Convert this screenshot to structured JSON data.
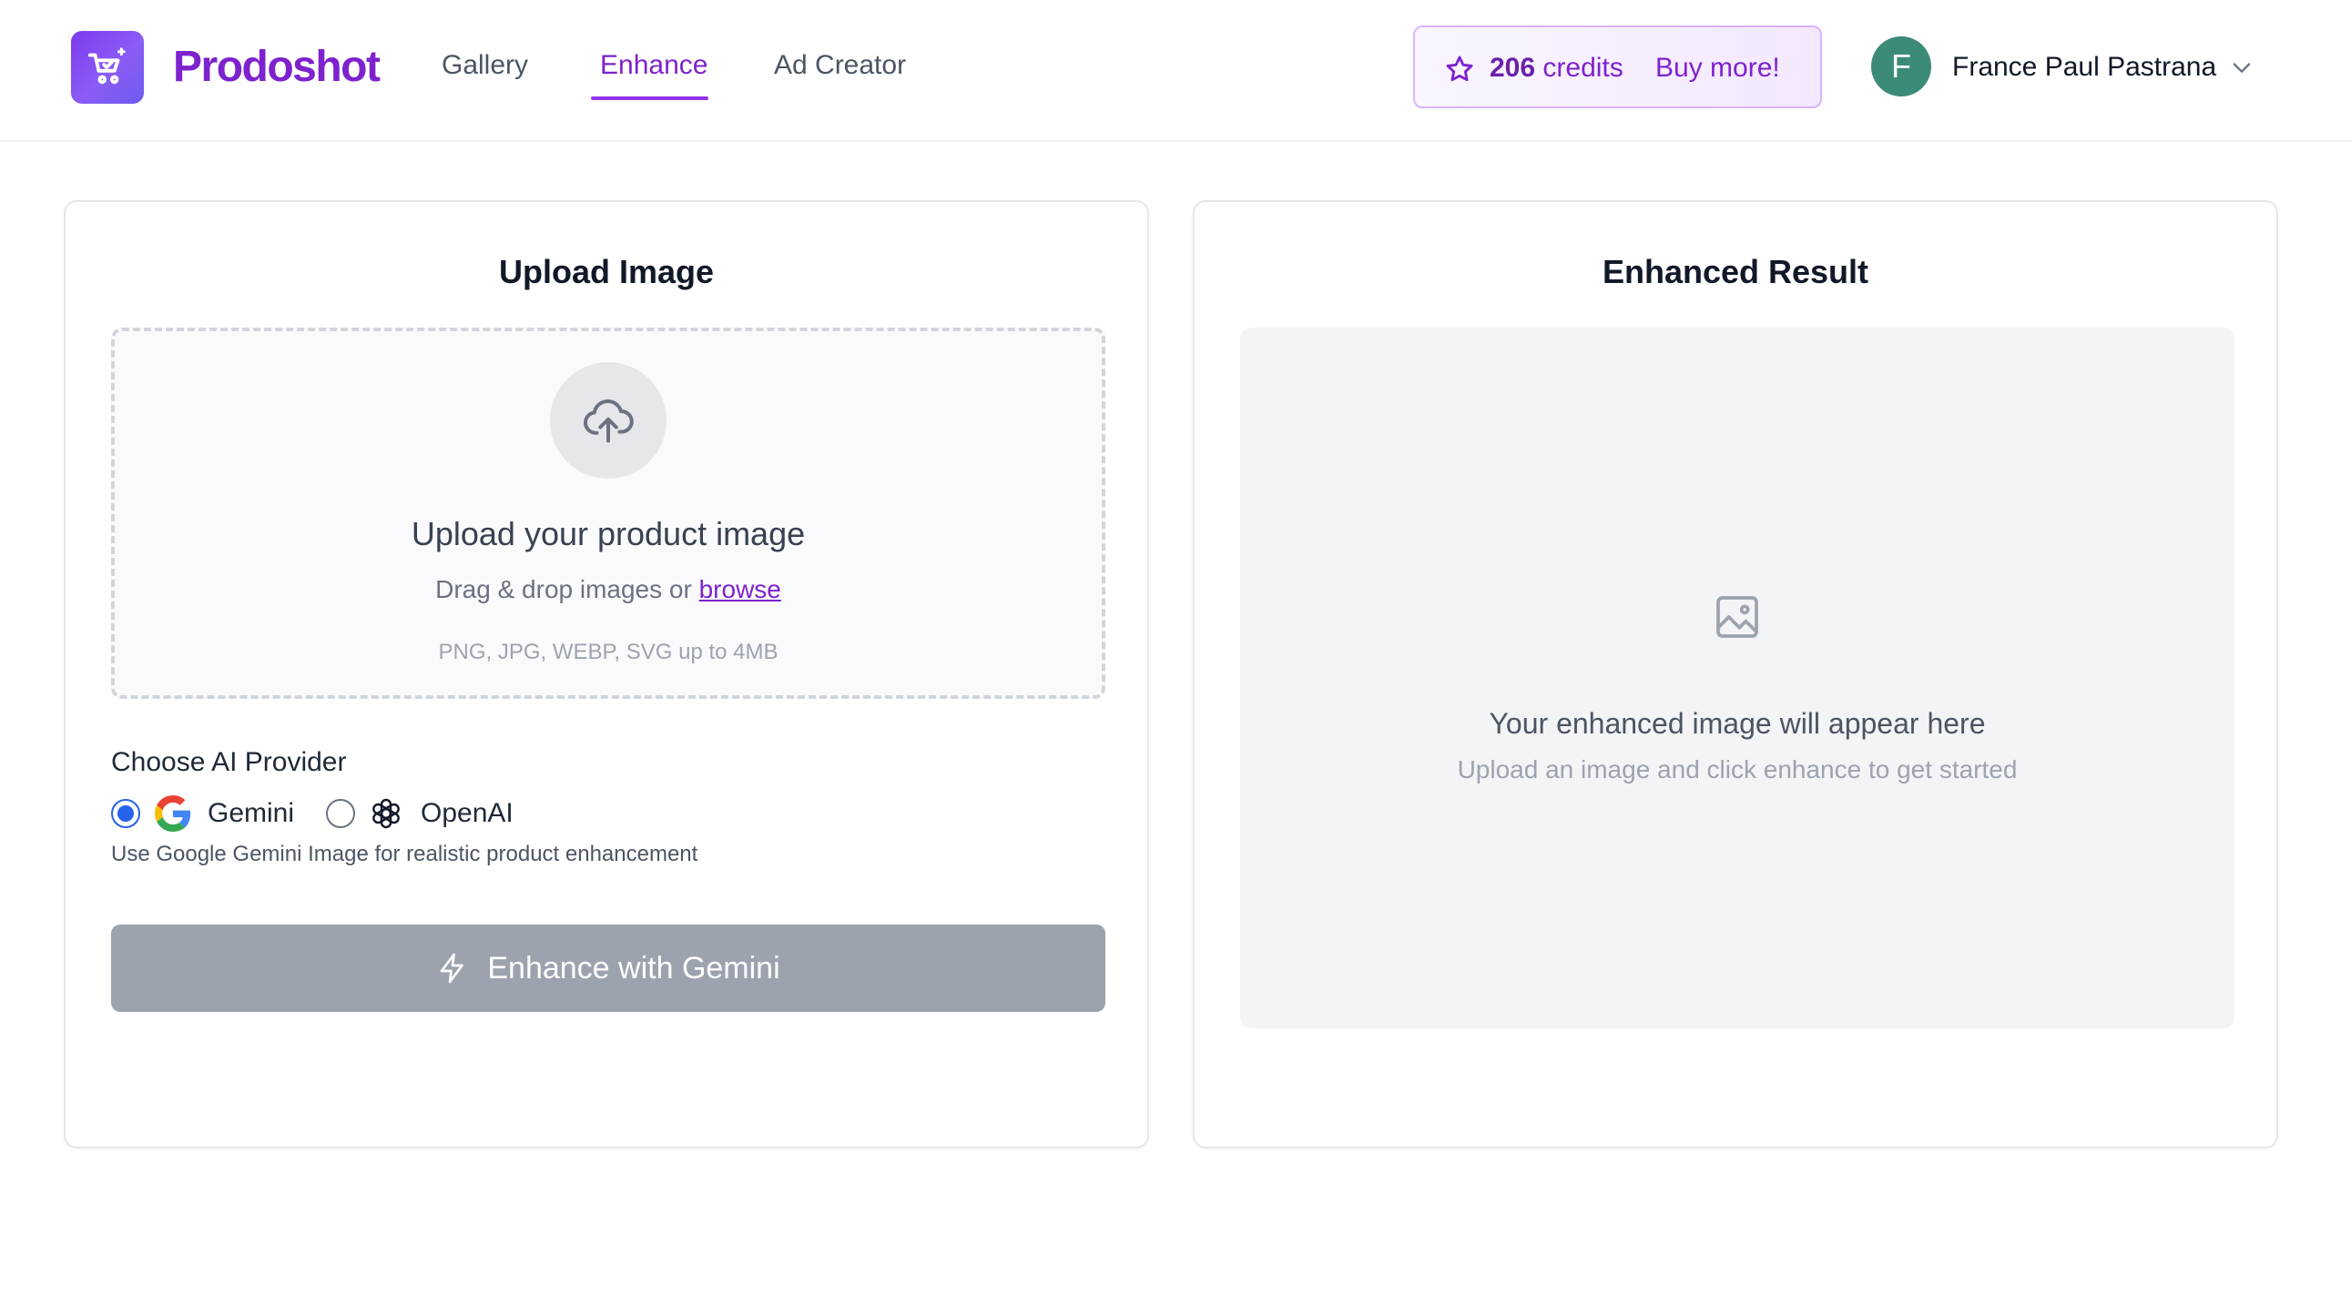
{
  "app": {
    "name": "Prodoshot",
    "brand_color": "#7e22ce",
    "logo_icon": "shopping-cart-sparkle-icon"
  },
  "nav": {
    "items": [
      {
        "label": "Gallery",
        "active": false
      },
      {
        "label": "Enhance",
        "active": true
      },
      {
        "label": "Ad Creator",
        "active": false
      }
    ]
  },
  "credits": {
    "icon": "star-icon",
    "count": "206",
    "unit": "credits",
    "buy_label": "Buy more!"
  },
  "user": {
    "initial": "F",
    "name": "France Paul Pastrana",
    "avatar_color": "#3c8a78"
  },
  "upload": {
    "title": "Upload Image",
    "dropzone_title": "Upload your product image",
    "dropzone_sub": "Drag & drop images or",
    "browse_label": "browse",
    "formats": "PNG, JPG, WEBP, SVG up to 4MB",
    "provider_label": "Choose AI Provider",
    "providers": [
      {
        "label": "Gemini",
        "icon": "google-icon",
        "selected": true
      },
      {
        "label": "OpenAI",
        "icon": "openai-icon",
        "selected": false
      }
    ],
    "provider_hint": "Use Google Gemini Image for realistic product enhancement",
    "enhance_button": "Enhance with Gemini",
    "enhance_icon": "lightning-icon"
  },
  "result": {
    "title": "Enhanced Result",
    "icon": "image-icon",
    "placeholder_title": "Your enhanced image will appear here",
    "placeholder_sub": "Upload an image and click enhance to get started"
  }
}
